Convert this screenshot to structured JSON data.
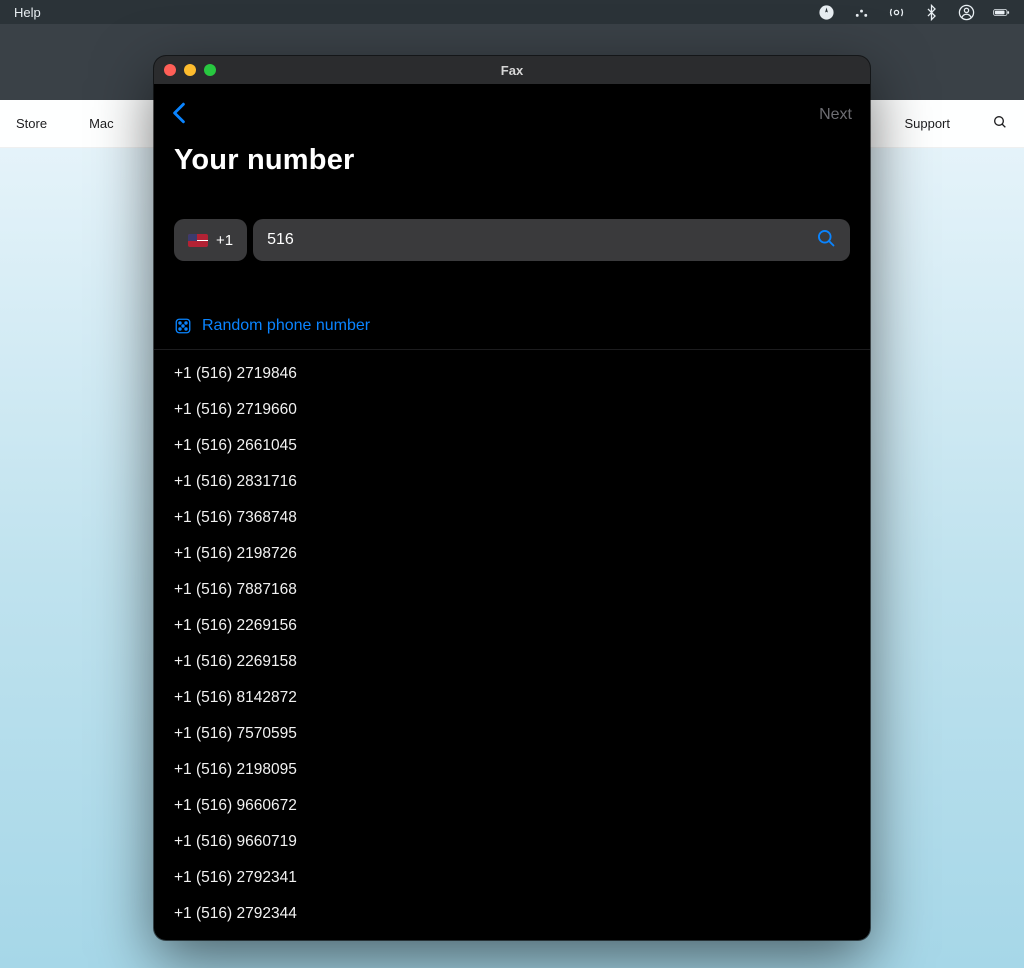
{
  "menubar": {
    "menu_item": "Help",
    "icons": [
      "location",
      "spotlight",
      "airdrop",
      "bluetooth",
      "account",
      "battery"
    ]
  },
  "apple_nav": {
    "items": [
      "Store",
      "Mac"
    ],
    "right_item": "Support"
  },
  "window": {
    "title": "Fax",
    "next_label": "Next",
    "page_title": "Your number",
    "country_code": "+1",
    "search_value": "516",
    "random_label": "Random phone number",
    "numbers": [
      "+1 (516) 2719846",
      "+1 (516) 2719660",
      "+1 (516) 2661045",
      "+1 (516) 2831716",
      "+1 (516) 7368748",
      "+1 (516) 2198726",
      "+1 (516) 7887168",
      "+1 (516) 2269156",
      "+1 (516) 2269158",
      "+1 (516) 8142872",
      "+1 (516) 7570595",
      "+1 (516) 2198095",
      "+1 (516) 9660672",
      "+1 (516) 9660719",
      "+1 (516) 2792341",
      "+1 (516) 2792344"
    ]
  }
}
